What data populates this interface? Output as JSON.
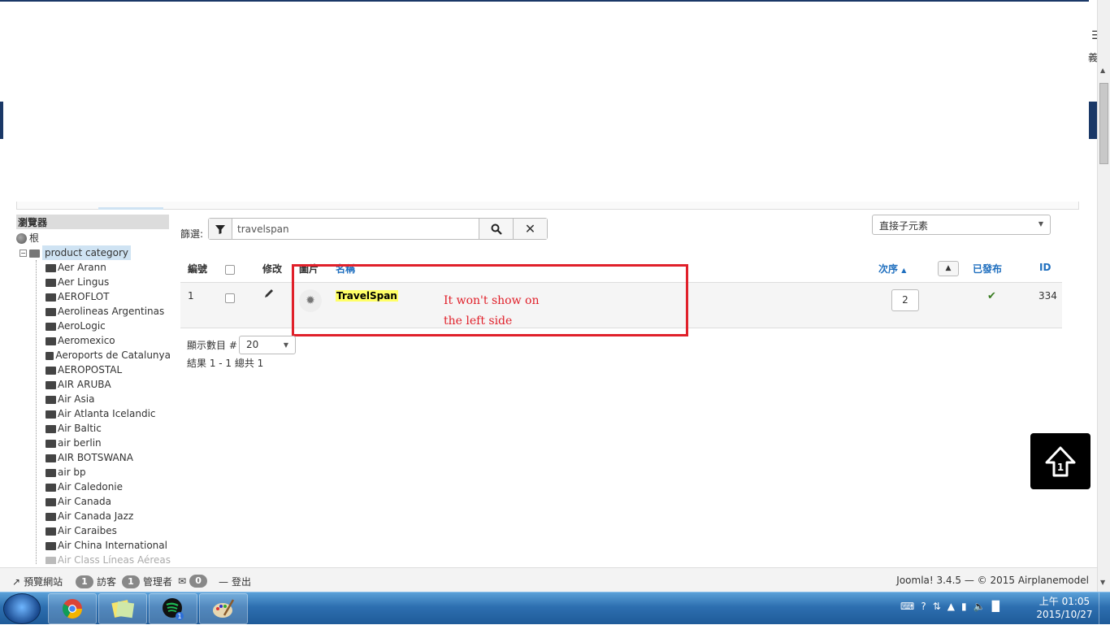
{
  "browser": {
    "title": "瀏覽器",
    "root_label": "根",
    "category_label": "product category",
    "items": [
      "Aer Arann",
      "Aer Lingus",
      "AEROFLOT",
      "Aerolineas Argentinas",
      "AeroLogic",
      "Aeromexico",
      "Aeroports de Catalunya",
      "AEROPOSTAL",
      "AIR ARUBA",
      "Air Asia",
      "Air Atlanta Icelandic",
      "Air Baltic",
      "air berlin",
      "AIR BOTSWANA",
      "air bp",
      "Air Caledonie",
      "Air Canada",
      "Air Canada Jazz",
      "Air Caraibes",
      "Air China International",
      "Air Class Líneas Aéreas"
    ]
  },
  "filter": {
    "label": "篩選:",
    "value": "travelspan",
    "search_icon": "search-icon",
    "clear_icon": "close-icon"
  },
  "direct_children_select": "直接子元素",
  "table": {
    "headers": {
      "number": "編號",
      "edit": "修改",
      "image": "圖片",
      "name": "名稱",
      "order": "次序",
      "published": "已發布",
      "id": "ID"
    },
    "rows": [
      {
        "number": "1",
        "name": "TravelSpan",
        "order": "2",
        "id": "334",
        "published": true
      }
    ]
  },
  "annotation": {
    "line1": "It won't show on",
    "line2": "the left side",
    "color": "#e0202a"
  },
  "pagination": {
    "limit_label": "顯示數目 #",
    "limit_value": "20",
    "results": "結果 1 - 1 總共 1"
  },
  "statusbar": {
    "preview": "預覽網站",
    "visitors_count": "1",
    "visitors_label": "訪客",
    "admins_count": "1",
    "admins_label": "管理者",
    "messages_count": "0",
    "logout": "登出",
    "version": "Joomla! 3.4.5 — © 2015 Airplanemodel"
  },
  "side_text": "義",
  "taskbar": {
    "apps": [
      "chrome-icon",
      "sticky-notes-icon",
      "spotify-icon",
      "paint-icon"
    ],
    "spotify_badge": "1",
    "time": "上午 01:05",
    "date": "2015/10/27"
  }
}
